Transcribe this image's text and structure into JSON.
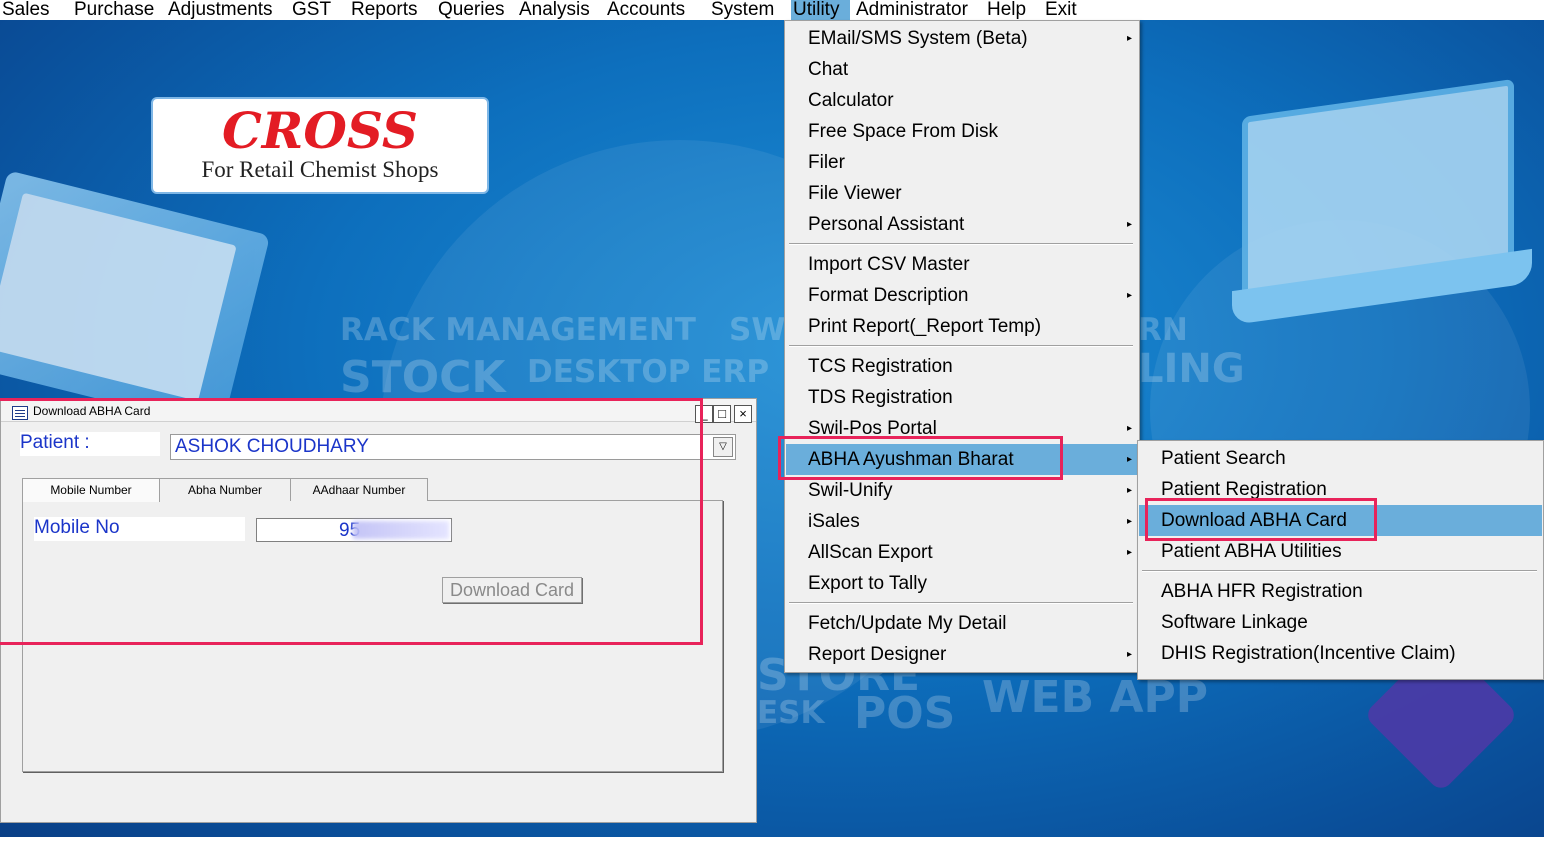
{
  "menubar": {
    "items": [
      "Sales",
      "Purchase",
      "Adjustments",
      "GST",
      "Reports",
      "Queries",
      "Analysis",
      "Accounts",
      "System",
      "Utility",
      "Administrator",
      "Help",
      "Exit"
    ],
    "active": "Utility"
  },
  "logo": {
    "title": "CROSS",
    "subtitle": "For Retail Chemist Shops"
  },
  "background_text": {
    "rack": "RACK MANAGEMENT",
    "sw": "SW",
    "rn": "RN",
    "stock": "STOCK",
    "desktop_erp": "DESKTOP ERP",
    "ling": "LING",
    "store": "STORE",
    "esk": "ESK",
    "pos": "POS",
    "web_app": "WEB APP"
  },
  "dialog": {
    "title": "Download ABHA Card",
    "patient_label": "Patient :",
    "patient_value": "ASHOK CHOUDHARY",
    "tabs": [
      "Mobile Number",
      "Abha Number",
      "AAdhaar Number"
    ],
    "active_tab": "Mobile Number",
    "mobile_label": "Mobile No",
    "mobile_value": "95",
    "download_button": "Download Card",
    "window_buttons": {
      "minimize": "_",
      "maximize": "□",
      "close": "×"
    }
  },
  "utility_menu": {
    "items": [
      {
        "label": "EMail/SMS System (Beta)",
        "submenu": true
      },
      {
        "label": "Chat",
        "submenu": false
      },
      {
        "label": "Calculator",
        "submenu": false
      },
      {
        "label": "Free Space From Disk",
        "submenu": false
      },
      {
        "label": "Filer",
        "submenu": false
      },
      {
        "label": "File Viewer",
        "submenu": false
      },
      {
        "label": "Personal Assistant",
        "submenu": true
      },
      {
        "label": "Import CSV Master",
        "submenu": false
      },
      {
        "label": "Format Description",
        "submenu": true
      },
      {
        "label": "Print Report(_Report Temp)",
        "submenu": false
      },
      {
        "label": "TCS Registration",
        "submenu": false
      },
      {
        "label": "TDS Registration",
        "submenu": false
      },
      {
        "label": "Swil-Pos Portal",
        "submenu": true
      },
      {
        "label": "ABHA Ayushman Bharat",
        "submenu": true
      },
      {
        "label": "Swil-Unify",
        "submenu": true
      },
      {
        "label": "iSales",
        "submenu": true
      },
      {
        "label": "AllScan Export",
        "submenu": true
      },
      {
        "label": "Export to Tally",
        "submenu": false
      },
      {
        "label": "Fetch/Update My Detail",
        "submenu": false
      },
      {
        "label": "Report Designer",
        "submenu": true
      }
    ],
    "highlighted": "ABHA Ayushman Bharat"
  },
  "abha_submenu": {
    "items": [
      {
        "label": "Patient Search"
      },
      {
        "label": "Patient Registration"
      },
      {
        "label": "Download ABHA Card"
      },
      {
        "label": "Patient ABHA Utilities"
      },
      {
        "label": "ABHA HFR Registration"
      },
      {
        "label": "Software Linkage"
      },
      {
        "label": "DHIS Registration(Incentive Claim)"
      }
    ],
    "highlighted": "Download ABHA Card"
  },
  "colors": {
    "menu_highlight": "#6aaedb",
    "annotation_box": "#e8235a",
    "label_blue": "#1b35c9",
    "logo_red": "#e31c24"
  }
}
